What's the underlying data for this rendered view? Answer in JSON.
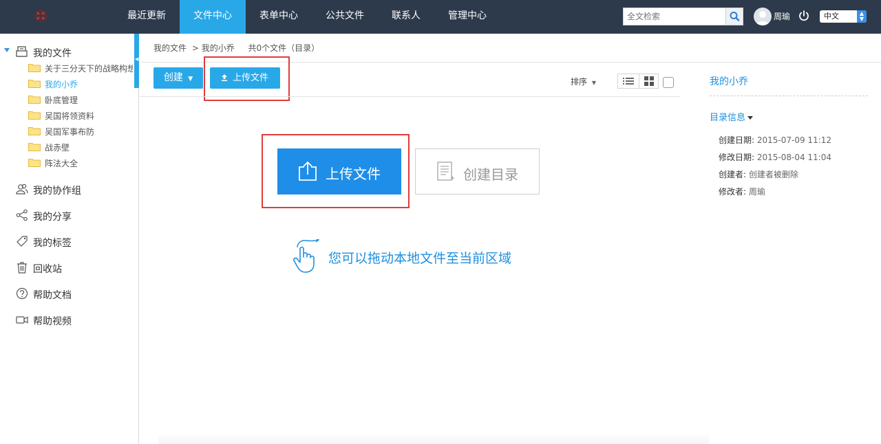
{
  "nav": {
    "items": [
      {
        "label": "最近更新",
        "active": false
      },
      {
        "label": "文件中心",
        "active": true
      },
      {
        "label": "表单中心",
        "active": false
      },
      {
        "label": "公共文件",
        "active": false
      },
      {
        "label": "联系人",
        "active": false
      },
      {
        "label": "管理中心",
        "active": false
      }
    ],
    "search_placeholder": "全文检索",
    "user_name": "周瑜",
    "language": "中文"
  },
  "sidebar": {
    "root_label": "我的文件",
    "folders": [
      {
        "label": "关于三分天下的战略构想",
        "active": false
      },
      {
        "label": "我的小乔",
        "active": true
      },
      {
        "label": "卧底管理",
        "active": false
      },
      {
        "label": "吴国将领资料",
        "active": false
      },
      {
        "label": "吴国军事布防",
        "active": false
      },
      {
        "label": "战赤壁",
        "active": false
      },
      {
        "label": "阵法大全",
        "active": false
      }
    ],
    "sections": [
      {
        "label": "我的协作组",
        "icon": "group-icon"
      },
      {
        "label": "我的分享",
        "icon": "share-icon"
      },
      {
        "label": "我的标签",
        "icon": "tag-icon"
      },
      {
        "label": "回收站",
        "icon": "trash-icon"
      },
      {
        "label": "帮助文档",
        "icon": "help-icon"
      },
      {
        "label": "帮助视频",
        "icon": "video-icon"
      }
    ]
  },
  "breadcrumb": {
    "root": "我的文件",
    "current": "> 我的小乔",
    "summary": "共0个文件（目录）"
  },
  "toolbar": {
    "create_label": "创建",
    "upload_label": "上传文件",
    "sort_label": "排序"
  },
  "empty_state": {
    "upload_label": "上传文件",
    "mkdir_label": "创建目录",
    "drag_hint": "您可以拖动本地文件至当前区域"
  },
  "info_panel": {
    "title": "我的小乔",
    "section_label": "目录信息",
    "rows": [
      {
        "key": "创建日期:",
        "value": "2015-07-09 11:12"
      },
      {
        "key": "修改日期:",
        "value": "2015-08-04 11:04"
      },
      {
        "key": "创建者:",
        "value": "创建者被删除"
      },
      {
        "key": "修改者:",
        "value": "周瑜"
      }
    ]
  },
  "colors": {
    "topbar": "#2d3a4b",
    "accent": "#29a8e8",
    "primary_button": "#1f8ee8",
    "highlight_box": "#e03b3b",
    "folder": "#f5c542"
  }
}
